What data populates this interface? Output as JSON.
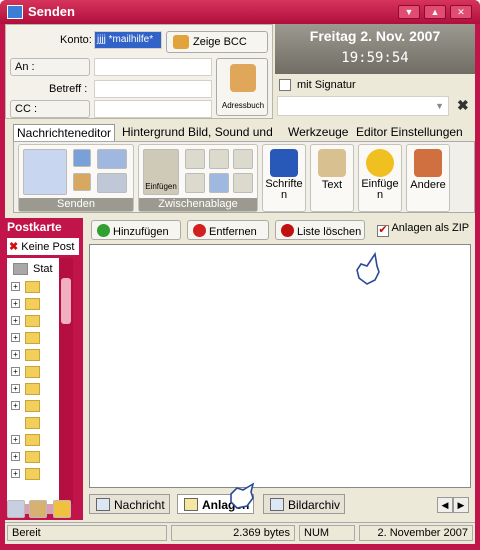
{
  "window": {
    "title": "Senden",
    "min": "▼",
    "max": "▲",
    "close": "✕"
  },
  "compose": {
    "konto_label": "Konto:",
    "konto_value": "jjjj *mailhilfe*",
    "bcc_label": "Zeige BCC",
    "an_label": "An :",
    "betreff_label": "Betreff :",
    "cc_label": "CC :",
    "adressbuch_label": "Adressbuch"
  },
  "datetime": {
    "date": "Freitag 2. Nov. 2007",
    "time": "19:59:54"
  },
  "signature": {
    "checkbox_label": "mit Signatur"
  },
  "ribbon": {
    "tabs": [
      "Nachrichteneditor",
      "Hintergrund Bild, Sound und",
      "Werkzeuge",
      "Editor Einstellungen"
    ],
    "group_senden": "Senden",
    "group_zwischenablage": "Zwischenablage",
    "einfuegen_small": "Einfügen",
    "schriften": "Schriften",
    "text": "Text",
    "einfuegen": "Einfügen",
    "andere": "Andere"
  },
  "leftpane": {
    "header": "Postkarte",
    "no_post": "Keine Post",
    "tree_root": "Stat"
  },
  "attachments": {
    "add": "Hinzufügen",
    "remove": "Entfernen",
    "clear": "Liste löschen",
    "zip": "Anlagen als ZIP",
    "zip_checked": true
  },
  "bottom_tabs": [
    "Nachricht",
    "Anlagen",
    "Bildarchiv"
  ],
  "status": {
    "state": "Bereit",
    "bytes": "2.369 bytes",
    "num": "NUM",
    "date": "2. November 2007"
  },
  "colors": {
    "accent": "#c0144a",
    "client": "#ece9d8"
  }
}
